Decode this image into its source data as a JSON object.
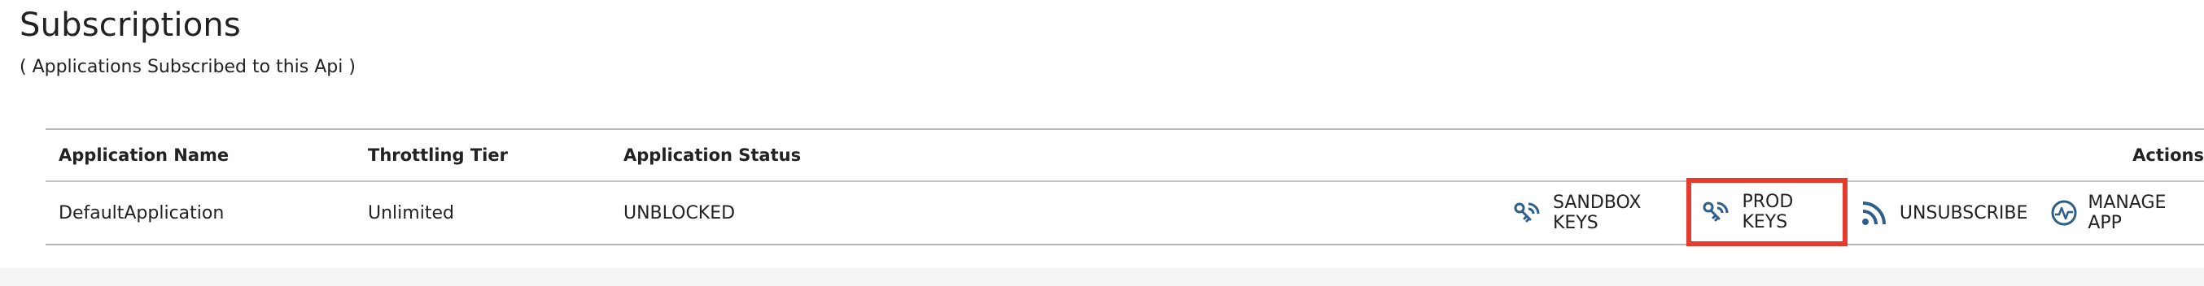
{
  "header": {
    "title": "Subscriptions",
    "subtitle": "( Applications Subscribed to this Api )"
  },
  "table": {
    "columns": {
      "application_name": "Application Name",
      "throttling_tier": "Throttling Tier",
      "application_status": "Application Status",
      "actions": "Actions"
    },
    "rows": [
      {
        "application_name": "DefaultApplication",
        "throttling_tier": "Unlimited",
        "application_status": "UNBLOCKED",
        "actions": [
          {
            "label": "SANDBOX KEYS",
            "icon": "keys-icon"
          },
          {
            "label": "PROD KEYS",
            "icon": "keys-icon",
            "highlighted": true
          },
          {
            "label": "UNSUBSCRIBE",
            "icon": "rss-icon"
          },
          {
            "label": "MANAGE APP",
            "icon": "manage-app-icon"
          }
        ]
      }
    ]
  },
  "colors": {
    "icon": "#2e5f8a",
    "highlight_border": "#e53b2c",
    "text": "#222222",
    "background": "#f5f5f5"
  }
}
